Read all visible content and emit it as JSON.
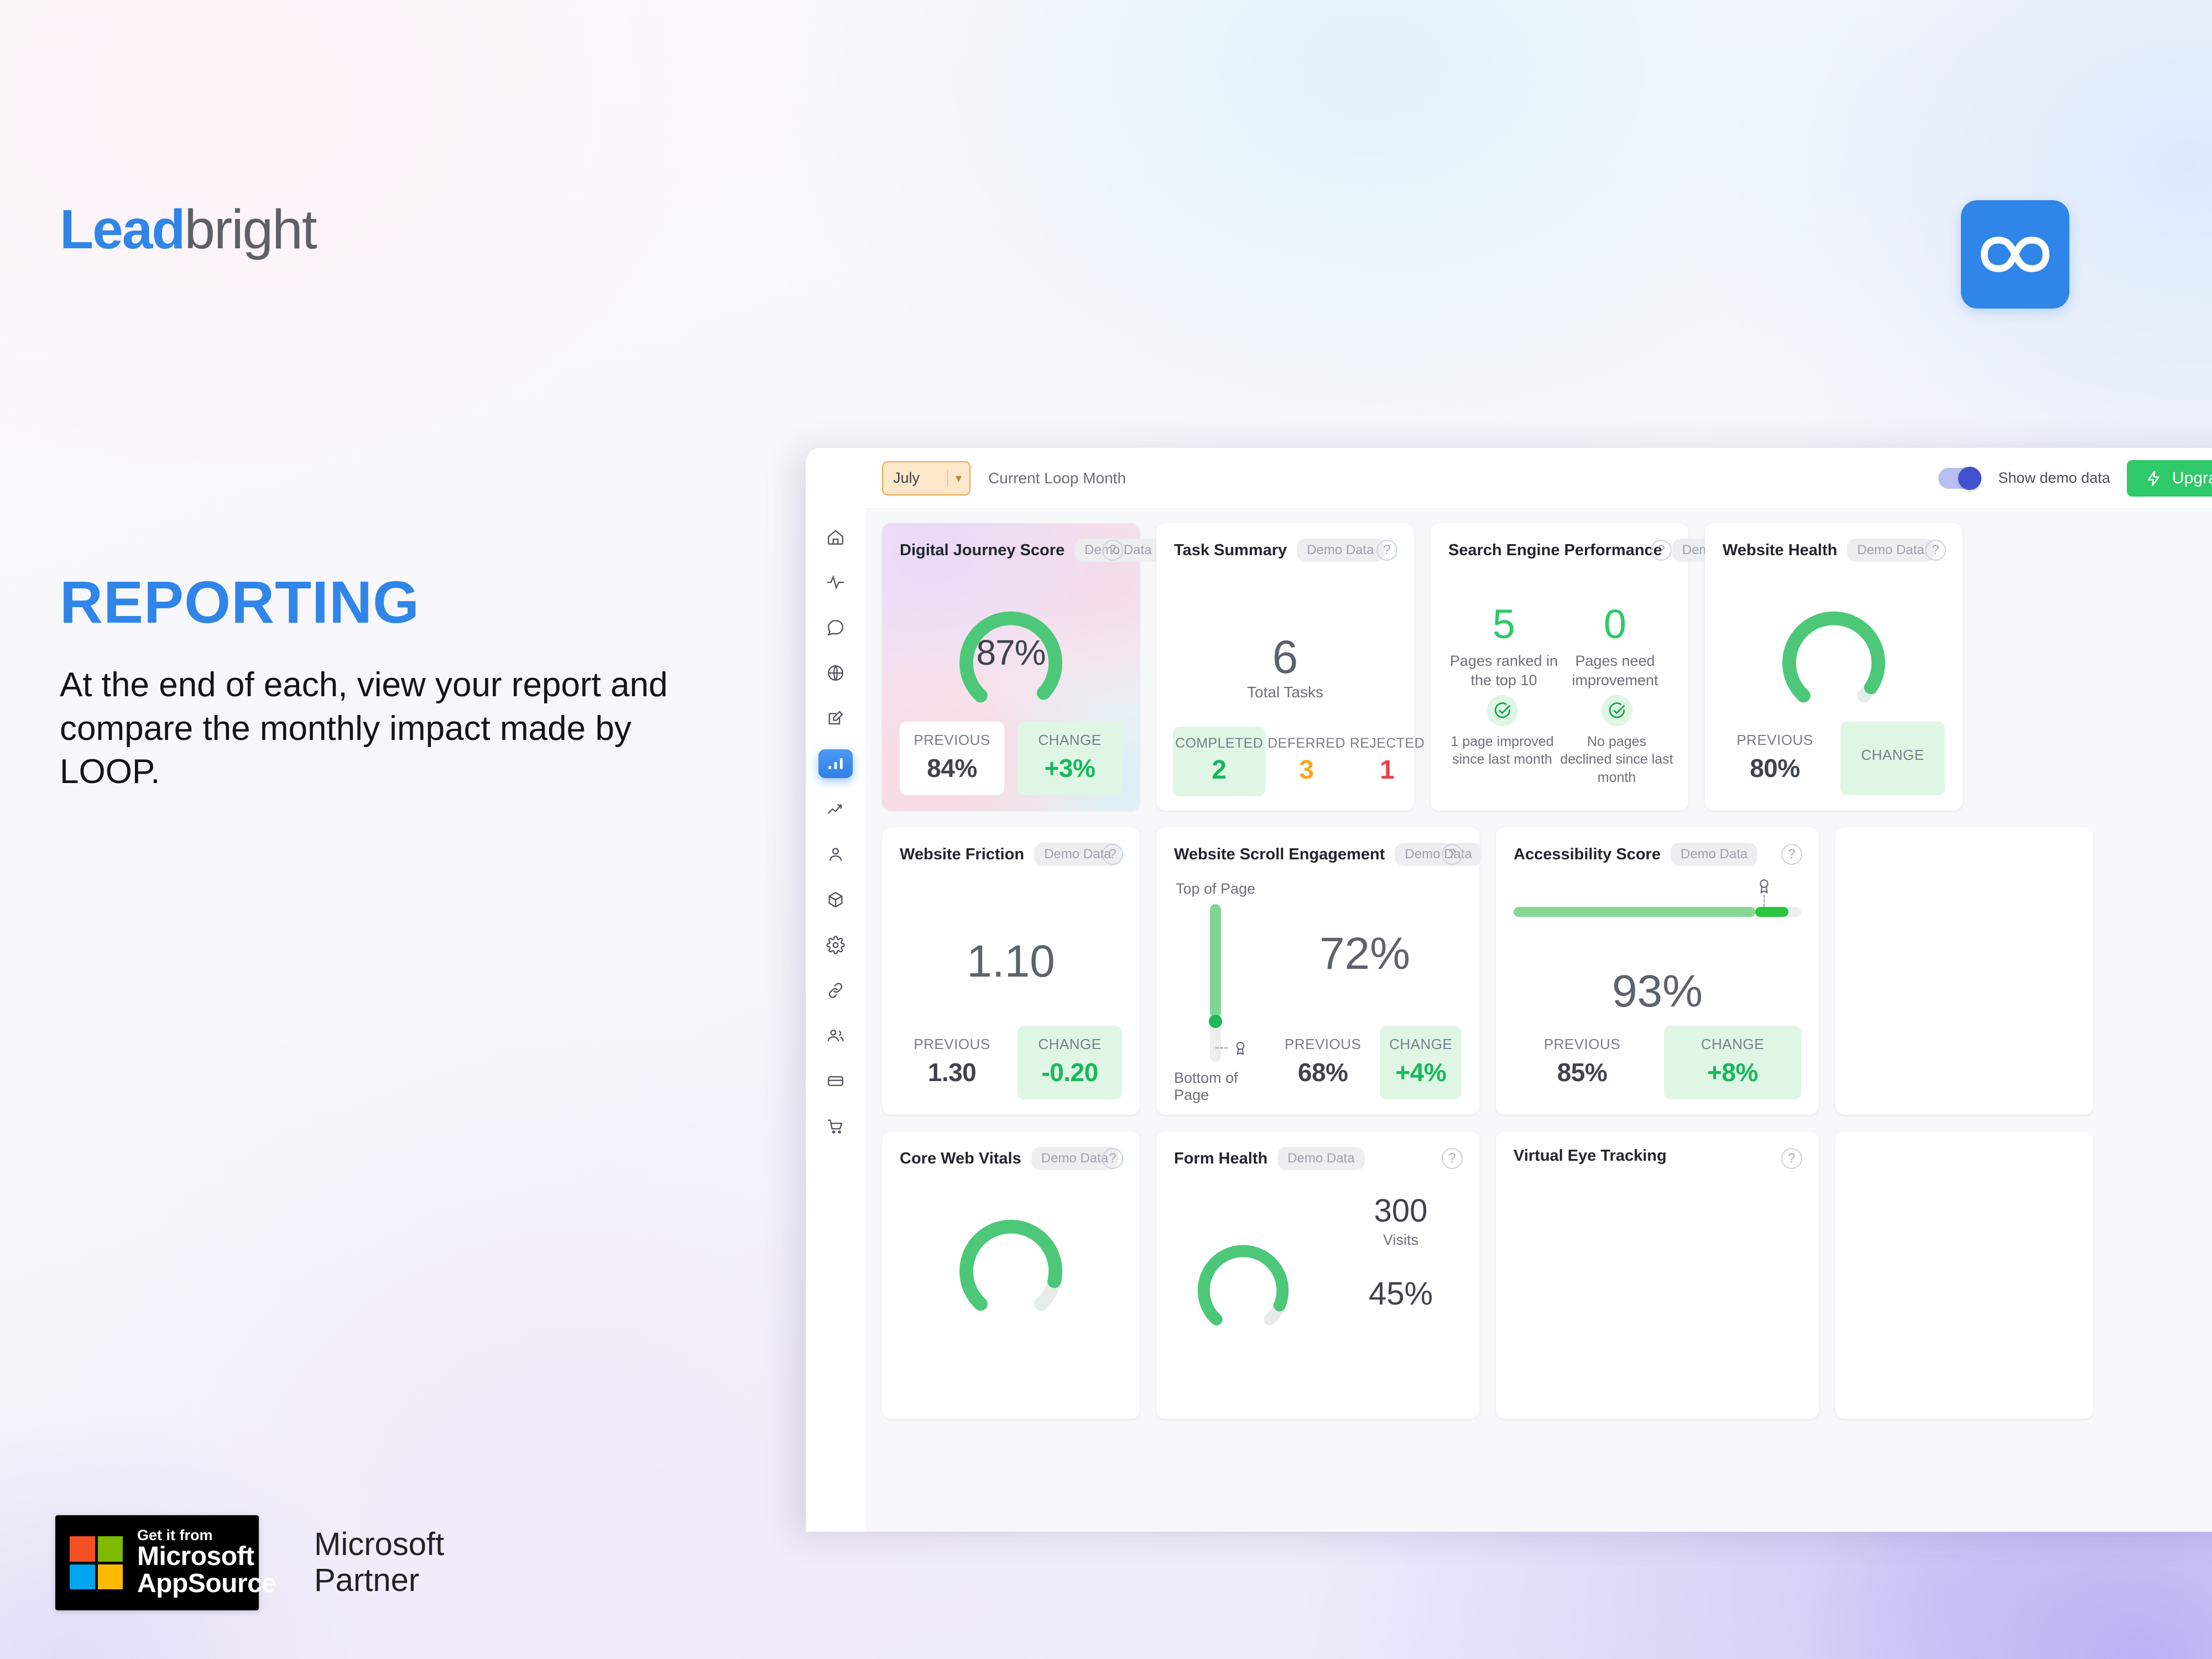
{
  "brand": {
    "logo_lead": "Lead",
    "logo_bright": "bright",
    "infinity_icon": "infinity-icon",
    "accent_blue": "#2f85e8",
    "accent_green": "#2ec968",
    "accent_purple": "#4150cf"
  },
  "hero": {
    "headline": "REPORTING",
    "body": "At the end of each, view your report and compare the monthly impact made by LOOP."
  },
  "badges": {
    "appsource_small": "Get it from",
    "appsource_line1": "Microsoft",
    "appsource_line2": "AppSource",
    "partner": "Microsoft\nPartner"
  },
  "dashboard": {
    "sidebar": [
      {
        "name": "home-icon",
        "active": false
      },
      {
        "name": "activity-icon",
        "active": false
      },
      {
        "name": "chat-icon",
        "active": false
      },
      {
        "name": "globe-icon",
        "active": false
      },
      {
        "name": "edit-icon",
        "active": false
      },
      {
        "name": "bar-chart-icon",
        "active": true
      },
      {
        "name": "trending-up-icon",
        "active": false
      },
      {
        "name": "user-icon",
        "active": false
      },
      {
        "name": "box-icon",
        "active": false
      },
      {
        "name": "gear-icon",
        "active": false
      },
      {
        "name": "link-icon",
        "active": false
      },
      {
        "name": "users-icon",
        "active": false
      },
      {
        "name": "card-icon",
        "active": false
      },
      {
        "name": "cart-icon",
        "active": false
      }
    ],
    "topbar": {
      "month": "July",
      "month_caption": "Current Loop Month",
      "demo_toggle_label": "Show demo data",
      "demo_toggle_on": true,
      "upgrade_label": "Upgrade",
      "bolt_icon": "bolt-icon"
    },
    "demo_pill": "Demo Data",
    "labels": {
      "previous": "PREVIOUS",
      "change": "CHANGE",
      "completed": "COMPLETED",
      "deferred": "DEFERRED",
      "rejected": "REJECTED",
      "total_tasks": "Total Tasks",
      "visits": "Visits",
      "top_of_page": "Top of Page",
      "bottom_of_page": "Bottom of Page"
    },
    "cards": {
      "digital_journey": {
        "title": "Digital Journey Score",
        "value": "87%",
        "previous": "84%",
        "change": "+3%"
      },
      "task_summary": {
        "title": "Task Summary",
        "total": "6",
        "completed": "2",
        "deferred": "3",
        "rejected": "1"
      },
      "search_engine": {
        "title": "Search Engine Performance",
        "ranked_value": "5",
        "ranked_caption": "Pages ranked in the top 10",
        "improve_value": "0",
        "improve_caption": "Pages need improvement",
        "note_left": "1 page improved since last month",
        "note_right": "No pages declined since last month"
      },
      "website_health": {
        "title": "Website Health",
        "previous": "80%"
      },
      "website_friction": {
        "title": "Website Friction",
        "value": "1.10",
        "previous": "1.30",
        "change": "-0.20"
      },
      "scroll_engagement": {
        "title": "Website Scroll Engagement",
        "value": "72%",
        "previous": "68%",
        "change": "+4%"
      },
      "accessibility": {
        "title": "Accessibility Score",
        "value": "93%",
        "previous": "85%",
        "change": "+8%"
      },
      "core_web_vitals": {
        "title": "Core Web Vitals"
      },
      "form_health": {
        "title": "Form Health",
        "visits": "300"
      },
      "virtual_eye_tracking": {
        "title": "Virtual Eye Tracking"
      }
    }
  },
  "chart_data": [
    {
      "type": "gauge",
      "title": "Digital Journey Score",
      "value": 87,
      "unit": "%",
      "previous": 84,
      "change": 3,
      "range": [
        0,
        100
      ],
      "color": "#4cc878"
    },
    {
      "type": "bar",
      "title": "Task Summary",
      "categories": [
        "COMPLETED",
        "DEFERRED",
        "REJECTED"
      ],
      "values": [
        2,
        3,
        1
      ],
      "total": 6,
      "ylabel": "Total Tasks",
      "colors": [
        "#12b85e",
        "#f5a623",
        "#e8434a"
      ]
    },
    {
      "type": "table",
      "title": "Search Engine Performance",
      "categories": [
        "Pages ranked in the top 10",
        "Pages need improvement"
      ],
      "values": [
        5,
        0
      ]
    },
    {
      "type": "gauge",
      "title": "Website Health",
      "value": 84,
      "unit": "%",
      "previous": 80,
      "range": [
        0,
        100
      ],
      "color": "#4cc878"
    },
    {
      "type": "scalar",
      "title": "Website Friction",
      "value": 1.1,
      "previous": 1.3,
      "change": -0.2
    },
    {
      "type": "bar",
      "title": "Website Scroll Engagement",
      "categories": [
        "Top of Page",
        "Bottom of Page"
      ],
      "values": [
        72,
        0
      ],
      "value": 72,
      "unit": "%",
      "previous": 68,
      "change": 4,
      "orientation": "vertical"
    },
    {
      "type": "bar",
      "title": "Accessibility Score",
      "categories": [
        "Score"
      ],
      "values": [
        93
      ],
      "value": 93,
      "unit": "%",
      "previous": 85,
      "change": 8,
      "xlim": [
        0,
        100
      ],
      "orientation": "horizontal"
    },
    {
      "type": "gauge",
      "title": "Core Web Vitals",
      "value": null,
      "unit": "%",
      "color": "#4cc878"
    },
    {
      "type": "gauge",
      "title": "Form Health",
      "value": null,
      "unit": "%",
      "annotations": [
        "300 Visits"
      ]
    }
  ]
}
